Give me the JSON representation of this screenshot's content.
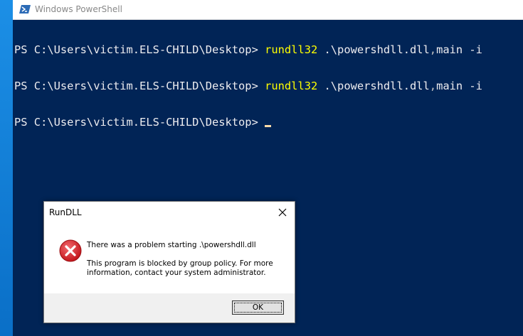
{
  "window": {
    "title": "Windows PowerShell",
    "background": "#012456"
  },
  "console": {
    "lines": [
      {
        "prompt": "PS C:\\Users\\victim.ELS-CHILD\\Desktop> ",
        "command": "rundll32",
        "args": " .\\powershdll.dll",
        "sep": ",",
        "args2": "main -i"
      },
      {
        "prompt": "PS C:\\Users\\victim.ELS-CHILD\\Desktop> ",
        "command": "rundll32",
        "args": " .\\powershdll.dll",
        "sep": ",",
        "args2": "main -i"
      },
      {
        "prompt": "PS C:\\Users\\victim.ELS-CHILD\\Desktop> "
      }
    ]
  },
  "dialog": {
    "title": "RunDLL",
    "heading": "There was a problem starting .\\powershdll.dll",
    "body": "This program is blocked by group policy. For more information, contact your system administrator.",
    "ok_label": "OK",
    "icon": "error-icon"
  },
  "colors": {
    "command": "#ffff00",
    "prompt": "#eeedf0",
    "error_red": "#d9272e",
    "desktop": "#0078d7"
  }
}
